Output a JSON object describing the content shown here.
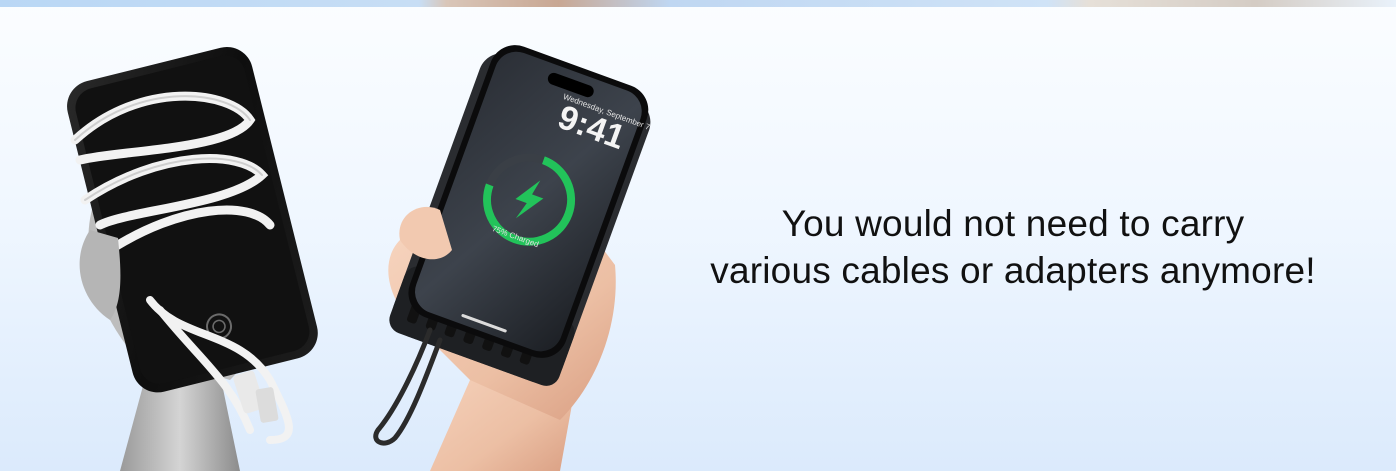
{
  "headline": {
    "line1": "You would not need to carry",
    "line2": "various cables or adapters anymore!"
  },
  "phone_screen": {
    "date": "Wednesday, September 7",
    "time": "9:41",
    "charge_status": "75% Charged"
  },
  "icons": {
    "left_hand_phone": "smartphone-with-cable-icon",
    "right_hand_device": "power-bank-with-phone-icon",
    "charging_bolt": "lightning-bolt-icon"
  },
  "colors": {
    "charging_ring": "#22c35a",
    "background_top": "#fbfdff",
    "background_bottom": "#dbeafc"
  }
}
